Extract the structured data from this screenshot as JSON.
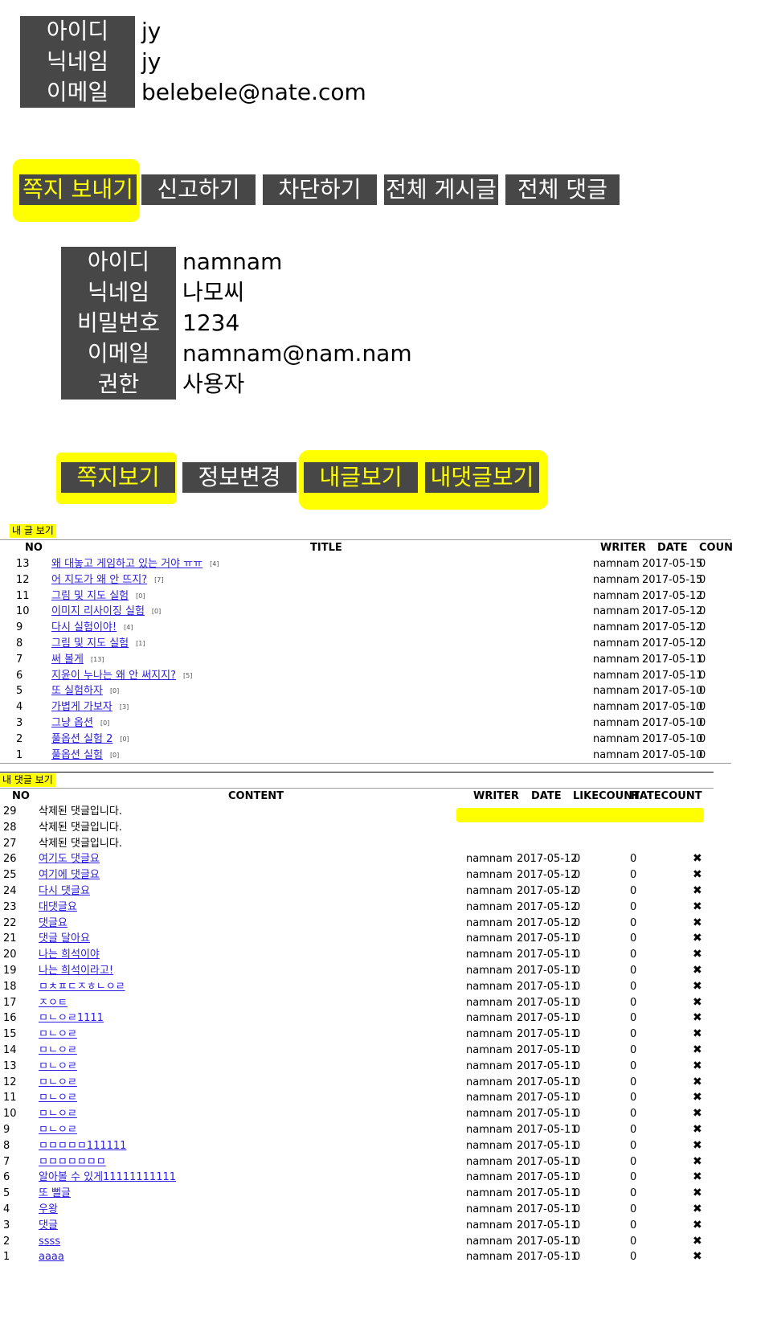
{
  "my_info": {
    "rows": [
      {
        "key": "아이디",
        "val": "jy"
      },
      {
        "key": "닉네임",
        "val": "jy"
      },
      {
        "key": "이메일",
        "val": "belebele@nate.com"
      }
    ]
  },
  "user_actions": [
    "쪽지 보내기",
    "신고하기",
    "차단하기",
    "전체 게시글",
    "전체 댓글"
  ],
  "user_info": {
    "rows": [
      {
        "key": "아이디",
        "val": "namnam"
      },
      {
        "key": "닉네임",
        "val": "나모씨"
      },
      {
        "key": "비밀번호",
        "val": "1234"
      },
      {
        "key": "이메일",
        "val": "namnam@nam.nam"
      },
      {
        "key": "권한",
        "val": "사용자"
      }
    ]
  },
  "my_actions": [
    "쪽지보기",
    "정보변경",
    "내글보기",
    "내댓글보기"
  ],
  "posts": {
    "title": "내 글 보기",
    "headers": {
      "no": "NO",
      "title": "TITLE",
      "writer": "WRITER",
      "date": "DATE",
      "count": "COUN"
    },
    "rows": [
      {
        "no": "13",
        "title": "왜 대놓고 게임하고 있는 거야 ㅠㅠ",
        "cnt": "[4]",
        "writer": "namnam",
        "date": "2017-05-15",
        "count": "0"
      },
      {
        "no": "12",
        "title": "어 지도가 왜 안 뜨지?",
        "cnt": "[7]",
        "writer": "namnam",
        "date": "2017-05-15",
        "count": "0"
      },
      {
        "no": "11",
        "title": "그림 및 지도 실험",
        "cnt": "[0]",
        "writer": "namnam",
        "date": "2017-05-12",
        "count": "0"
      },
      {
        "no": "10",
        "title": "이미지 리사이징 실험",
        "cnt": "[0]",
        "writer": "namnam",
        "date": "2017-05-12",
        "count": "0"
      },
      {
        "no": "9",
        "title": "다시 실험이야!",
        "cnt": "[4]",
        "writer": "namnam",
        "date": "2017-05-12",
        "count": "0"
      },
      {
        "no": "8",
        "title": "그림 및 지도 실험",
        "cnt": "[1]",
        "writer": "namnam",
        "date": "2017-05-12",
        "count": "0"
      },
      {
        "no": "7",
        "title": "써 볼게",
        "cnt": "[13]",
        "writer": "namnam",
        "date": "2017-05-11",
        "count": "0"
      },
      {
        "no": "6",
        "title": "지윤이 누나는 왜 안 써지지?",
        "cnt": "[5]",
        "writer": "namnam",
        "date": "2017-05-11",
        "count": "0"
      },
      {
        "no": "5",
        "title": "또 실험하자",
        "cnt": "[0]",
        "writer": "namnam",
        "date": "2017-05-10",
        "count": "0"
      },
      {
        "no": "4",
        "title": "가볍게 가보자",
        "cnt": "[3]",
        "writer": "namnam",
        "date": "2017-05-10",
        "count": "0"
      },
      {
        "no": "3",
        "title": "그냥 옵션",
        "cnt": "[0]",
        "writer": "namnam",
        "date": "2017-05-10",
        "count": "0"
      },
      {
        "no": "2",
        "title": "풀옵션 실험 2",
        "cnt": "[0]",
        "writer": "namnam",
        "date": "2017-05-10",
        "count": "0"
      },
      {
        "no": "1",
        "title": "풀옵션 실험",
        "cnt": "[0]",
        "writer": "namnam",
        "date": "2017-05-10",
        "count": "0"
      }
    ]
  },
  "comments": {
    "title": "내 댓글 보기",
    "headers": {
      "no": "NO",
      "content": "CONTENT",
      "writer": "WRITER",
      "date": "DATE",
      "like": "LIKECOUNT",
      "hate": "HATECOUNT"
    },
    "delete_icon": "close-icon",
    "rows": [
      {
        "no": "29",
        "content": "삭제된 댓글입니다.",
        "deleted": true
      },
      {
        "no": "28",
        "content": "삭제된 댓글입니다.",
        "deleted": true
      },
      {
        "no": "27",
        "content": "삭제된 댓글입니다.",
        "deleted": true
      },
      {
        "no": "26",
        "content": "여기도 댓글요",
        "writer": "namnam",
        "date": "2017-05-12",
        "like": "0",
        "hate": "0"
      },
      {
        "no": "25",
        "content": "여기에 댓글요",
        "writer": "namnam",
        "date": "2017-05-12",
        "like": "0",
        "hate": "0"
      },
      {
        "no": "24",
        "content": "다시 댓글요",
        "writer": "namnam",
        "date": "2017-05-12",
        "like": "0",
        "hate": "0"
      },
      {
        "no": "23",
        "content": "대댓글요",
        "writer": "namnam",
        "date": "2017-05-12",
        "like": "0",
        "hate": "0"
      },
      {
        "no": "22",
        "content": "댓글요",
        "writer": "namnam",
        "date": "2017-05-12",
        "like": "0",
        "hate": "0"
      },
      {
        "no": "21",
        "content": "댓글 달아요",
        "writer": "namnam",
        "date": "2017-05-11",
        "like": "0",
        "hate": "0"
      },
      {
        "no": "20",
        "content": "나는 희석이야",
        "writer": "namnam",
        "date": "2017-05-11",
        "like": "0",
        "hate": "0"
      },
      {
        "no": "19",
        "content": "나는 희석이라고!",
        "writer": "namnam",
        "date": "2017-05-11",
        "like": "0",
        "hate": "0"
      },
      {
        "no": "18",
        "content": "ㅁㅊㅍㄷㅈㅎㄴㅇㄹ",
        "writer": "namnam",
        "date": "2017-05-11",
        "like": "0",
        "hate": "0"
      },
      {
        "no": "17",
        "content": "ㅈㅇㅌ",
        "writer": "namnam",
        "date": "2017-05-11",
        "like": "0",
        "hate": "0"
      },
      {
        "no": "16",
        "content": "ㅁㄴㅇㄹ1111",
        "writer": "namnam",
        "date": "2017-05-11",
        "like": "0",
        "hate": "0"
      },
      {
        "no": "15",
        "content": "ㅁㄴㅇㄹ",
        "writer": "namnam",
        "date": "2017-05-11",
        "like": "0",
        "hate": "0"
      },
      {
        "no": "14",
        "content": "ㅁㄴㅇㄹ",
        "writer": "namnam",
        "date": "2017-05-11",
        "like": "0",
        "hate": "0"
      },
      {
        "no": "13",
        "content": "ㅁㄴㅇㄹ",
        "writer": "namnam",
        "date": "2017-05-11",
        "like": "0",
        "hate": "0"
      },
      {
        "no": "12",
        "content": "ㅁㄴㅇㄹ",
        "writer": "namnam",
        "date": "2017-05-11",
        "like": "0",
        "hate": "0"
      },
      {
        "no": "11",
        "content": "ㅁㄴㅇㄹ",
        "writer": "namnam",
        "date": "2017-05-11",
        "like": "0",
        "hate": "0"
      },
      {
        "no": "10",
        "content": "ㅁㄴㅇㄹ",
        "writer": "namnam",
        "date": "2017-05-11",
        "like": "0",
        "hate": "0"
      },
      {
        "no": "9",
        "content": "ㅁㄴㅇㄹ",
        "writer": "namnam",
        "date": "2017-05-11",
        "like": "0",
        "hate": "0"
      },
      {
        "no": "8",
        "content": "ㅁㅁㅁㅁㅁ111111",
        "writer": "namnam",
        "date": "2017-05-11",
        "like": "0",
        "hate": "0"
      },
      {
        "no": "7",
        "content": "ㅁㅁㅁㅁㅁㅁㅁ",
        "writer": "namnam",
        "date": "2017-05-11",
        "like": "0",
        "hate": "0"
      },
      {
        "no": "6",
        "content": "알아볼 수 있게11111111111",
        "writer": "namnam",
        "date": "2017-05-11",
        "like": "0",
        "hate": "0"
      },
      {
        "no": "5",
        "content": "또 뻘글",
        "writer": "namnam",
        "date": "2017-05-11",
        "like": "0",
        "hate": "0"
      },
      {
        "no": "4",
        "content": "우왕",
        "writer": "namnam",
        "date": "2017-05-11",
        "like": "0",
        "hate": "0"
      },
      {
        "no": "3",
        "content": "댓글",
        "writer": "namnam",
        "date": "2017-05-11",
        "like": "0",
        "hate": "0"
      },
      {
        "no": "2",
        "content": "ssss",
        "writer": "namnam",
        "date": "2017-05-11",
        "like": "0",
        "hate": "0"
      },
      {
        "no": "1",
        "content": "aaaa",
        "writer": "namnam",
        "date": "2017-05-11",
        "like": "0",
        "hate": "0"
      }
    ]
  }
}
